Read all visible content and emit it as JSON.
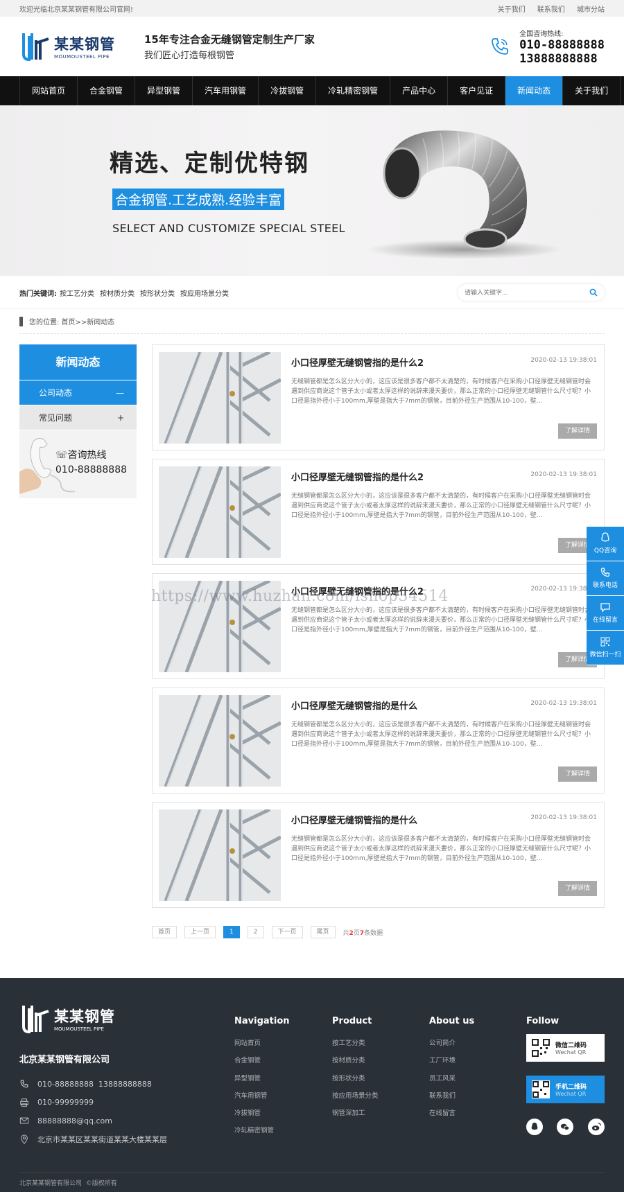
{
  "topbar": {
    "welcome": "欢迎光临北京某某钢管有限公司官网!",
    "links": [
      "关于我们",
      "联系我们",
      "城市分站"
    ]
  },
  "header": {
    "logo_cn": "某某钢管",
    "logo_en": "MOUMOUSTEEL PIPE",
    "slogan_main": "15年专注合金无缝钢管定制生产厂家",
    "slogan_sub": "我们匠心打造每根钢管",
    "hotline_label": "全国咨询热线:",
    "hotline_1": "010-88888888",
    "hotline_2": "13888888888"
  },
  "nav": [
    "网站首页",
    "合金钢管",
    "异型钢管",
    "汽车用钢管",
    "冷拔钢管",
    "冷轧精密钢管",
    "产品中心",
    "客户见证",
    "新闻动态",
    "关于我们"
  ],
  "nav_active_index": 8,
  "banner": {
    "title": "精选、定制优特钢",
    "tagline": "合金钢管.工艺成熟.经验丰富",
    "english": "SELECT AND CUSTOMIZE SPECIAL STEEL"
  },
  "keywords": {
    "label": "热门关键词:",
    "items": [
      "按工艺分类",
      "按材质分类",
      "按形状分类",
      "按应用场景分类"
    ],
    "search_placeholder": "请输入关键字..."
  },
  "breadcrumb": "您的位置: 首页>>新闻动态",
  "sidebar": {
    "title": "新闻动态",
    "items": [
      {
        "label": "公司动态",
        "sign": "—"
      },
      {
        "label": "常见问题",
        "sign": "+"
      }
    ],
    "contact_label": "咨询热线",
    "contact_number": "010-88888888"
  },
  "articles": [
    {
      "title": "小口径厚壁无缝钢管指的是什么2",
      "date": "2020-02-13 19:38:01",
      "desc": "无缝钢管都是怎么区分大小的，这应该是很多客户都不太清楚的，有时候客户在采购小口径厚壁无缝钢管时会遇到供应商说这个管子太小或者太厚这样的说辞来漫天要价，那么正常的小口径厚壁无缝钢管什么尺寸呢？小口径是指外径小于100mm,厚壁是指大于7mm的钢管，目前外径生产范围从10-100，壁...",
      "more": "了解详情"
    },
    {
      "title": "小口径厚壁无缝钢管指的是什么2",
      "date": "2020-02-13 19:38:01",
      "desc": "无缝钢管都是怎么区分大小的，这应该是很多客户都不太清楚的，有时候客户在采购小口径厚壁无缝钢管时会遇到供应商说这个管子太小或者太厚这样的说辞来漫天要价，那么正常的小口径厚壁无缝钢管什么尺寸呢？小口径是指外径小于100mm,厚壁是指大于7mm的钢管，目前外径生产范围从10-100，壁...",
      "more": "了解详情"
    },
    {
      "title": "小口径厚壁无缝钢管指的是什么2",
      "date": "2020-02-13 19:38:01",
      "desc": "无缝钢管都是怎么区分大小的，这应该是很多客户都不太清楚的，有时候客户在采购小口径厚壁无缝钢管时会遇到供应商说这个管子太小或者太厚这样的说辞来漫天要价，那么正常的小口径厚壁无缝钢管什么尺寸呢？小口径是指外径小于100mm,厚壁是指大于7mm的钢管，目前外径生产范围从10-100，壁...",
      "more": "了解详情"
    },
    {
      "title": "小口径厚壁无缝钢管指的是什么",
      "date": "2020-02-13 19:38:01",
      "desc": "无缝钢管都是怎么区分大小的，这应该是很多客户都不太清楚的，有时候客户在采购小口径厚壁无缝钢管时会遇到供应商说这个管子太小或者太厚这样的说辞来漫天要价，那么正常的小口径厚壁无缝钢管什么尺寸呢？小口径是指外径小于100mm,厚壁是指大于7mm的钢管，目前外径生产范围从10-100，壁...",
      "more": "了解详情"
    },
    {
      "title": "小口径厚壁无缝钢管指的是什么",
      "date": "2020-02-13 19:38:01",
      "desc": "无缝钢管都是怎么区分大小的，这应该是很多客户都不太清楚的，有时候客户在采购小口径厚壁无缝钢管时会遇到供应商说这个管子太小或者太厚这样的说辞来漫天要价，那么正常的小口径厚壁无缝钢管什么尺寸呢？小口径是指外径小于100mm,厚壁是指大于7mm的钢管，目前外径生产范围从10-100，壁...",
      "more": "了解详情"
    }
  ],
  "pager": {
    "first": "首页",
    "prev": "上一页",
    "pages": [
      "1",
      "2"
    ],
    "current": "1",
    "next": "下一页",
    "last": "尾页",
    "info_a": "共",
    "total_pages": "2",
    "info_b": "页",
    "total_items": "7",
    "info_c": "条数据"
  },
  "watermark": "https://www.huzhan.com/ishop34514",
  "float": [
    "QQ咨询",
    "联系电话",
    "在线留言",
    "微信扫一扫"
  ],
  "footer": {
    "logo_cn": "某某钢管",
    "logo_en": "MOUMOUSTEEL PIPE",
    "company": "北京某某钢管有限公司",
    "phone": "010-88888888  13888888888",
    "fax": "010-99999999",
    "email": "88888888@qq.com",
    "address": "北京市某某区某某街道某某大楼某某层",
    "nav_title": "Navigation",
    "nav_links": [
      "网站首页",
      "合金钢管",
      "异型钢管",
      "汽车用钢管",
      "冷拔钢管",
      "冷轧精密钢管"
    ],
    "product_title": "Product",
    "product_links": [
      "按工艺分类",
      "按材质分类",
      "按形状分类",
      "按应用场景分类",
      "钢管深加工"
    ],
    "about_title": "About us",
    "about_links": [
      "公司简介",
      "工厂环境",
      "员工风采",
      "联系我们",
      "在线留言"
    ],
    "follow_title": "Follow",
    "qr1_title": "微信二维码",
    "qr1_en": "Wechat QR",
    "qr2_title": "手机二维码",
    "qr2_en": "Wechat QR",
    "copyright": "北京某某钢管有限公司  ©版权所有"
  },
  "colors": {
    "accent": "#1e8ee0",
    "nav_bg": "#111111",
    "footer_bg": "#2a3037"
  }
}
